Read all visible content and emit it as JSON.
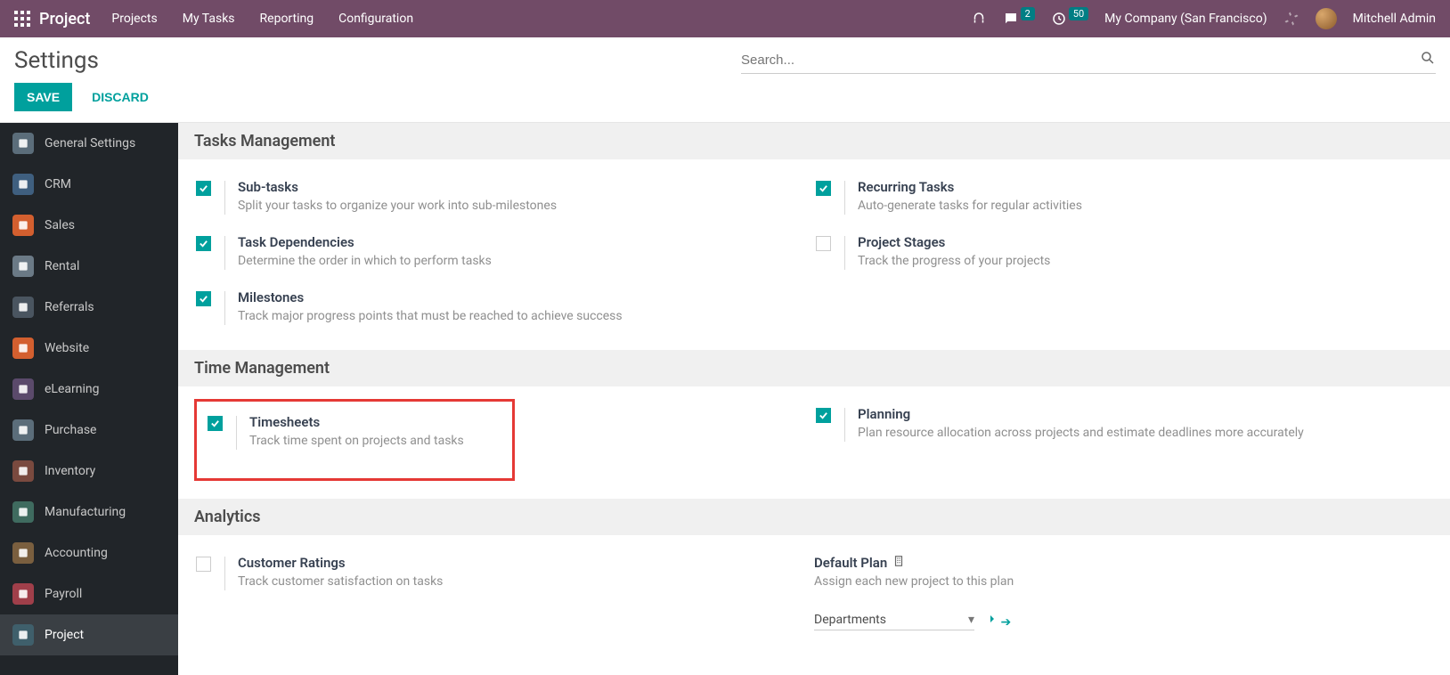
{
  "navbar": {
    "brand": "Project",
    "menu": [
      "Projects",
      "My Tasks",
      "Reporting",
      "Configuration"
    ],
    "messages_badge": "2",
    "activities_badge": "50",
    "company": "My Company (San Francisco)",
    "user": "Mitchell Admin"
  },
  "control_panel": {
    "title": "Settings",
    "search_placeholder": "Search...",
    "save": "SAVE",
    "discard": "DISCARD"
  },
  "sidebar": {
    "items": [
      {
        "label": "General Settings",
        "name": "general-settings",
        "bg": "#5b6d7a"
      },
      {
        "label": "CRM",
        "name": "crm",
        "bg": "#3f5f7f"
      },
      {
        "label": "Sales",
        "name": "sales",
        "bg": "#d35f2f"
      },
      {
        "label": "Rental",
        "name": "rental",
        "bg": "#6b7a86"
      },
      {
        "label": "Referrals",
        "name": "referrals",
        "bg": "#4a5560"
      },
      {
        "label": "Website",
        "name": "website",
        "bg": "#d35f2f"
      },
      {
        "label": "eLearning",
        "name": "elearning",
        "bg": "#5b4a6b"
      },
      {
        "label": "Purchase",
        "name": "purchase",
        "bg": "#5b6d7a"
      },
      {
        "label": "Inventory",
        "name": "inventory",
        "bg": "#7a4a3f"
      },
      {
        "label": "Manufacturing",
        "name": "manufacturing",
        "bg": "#3f6b5f"
      },
      {
        "label": "Accounting",
        "name": "accounting",
        "bg": "#7a5f3f"
      },
      {
        "label": "Payroll",
        "name": "payroll",
        "bg": "#a03f4a"
      },
      {
        "label": "Project",
        "name": "project",
        "bg": "#3f5f6b"
      }
    ],
    "active": "project"
  },
  "sections": {
    "tasks": {
      "title": "Tasks Management",
      "items_left": [
        {
          "title": "Sub-tasks",
          "desc": "Split your tasks to organize your work into sub-milestones",
          "checked": true
        },
        {
          "title": "Task Dependencies",
          "desc": "Determine the order in which to perform tasks",
          "checked": true
        },
        {
          "title": "Milestones",
          "desc": "Track major progress points that must be reached to achieve success",
          "checked": true
        }
      ],
      "items_right": [
        {
          "title": "Recurring Tasks",
          "desc": "Auto-generate tasks for regular activities",
          "checked": true
        },
        {
          "title": "Project Stages",
          "desc": "Track the progress of your projects",
          "checked": false
        }
      ]
    },
    "time": {
      "title": "Time Management",
      "items_left": [
        {
          "title": "Timesheets",
          "desc": "Track time spent on projects and tasks",
          "checked": true
        }
      ],
      "items_right": [
        {
          "title": "Planning",
          "desc": "Plan resource allocation across projects and estimate deadlines more accurately",
          "checked": true
        }
      ]
    },
    "analytics": {
      "title": "Analytics",
      "items_left": [
        {
          "title": "Customer Ratings",
          "desc": "Track customer satisfaction on tasks",
          "checked": false
        }
      ],
      "plan": {
        "title": "Default Plan",
        "desc": "Assign each new project to this plan",
        "value": "Departments"
      }
    }
  }
}
